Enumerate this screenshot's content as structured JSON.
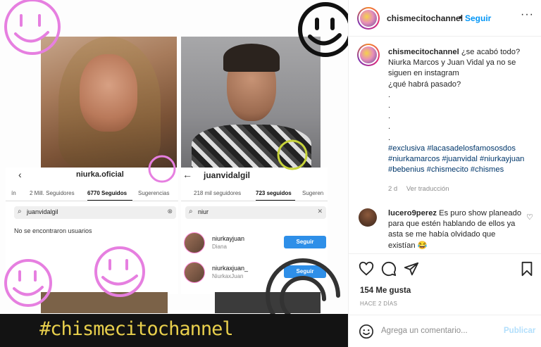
{
  "media": {
    "left_panel": {
      "username": "niurka.oficial",
      "tabs": [
        "ín",
        "2 Mill. Seguidores",
        "6770 Seguidos",
        "Sugerencias"
      ],
      "search_value": "juanvidalgil",
      "empty_text": "No se encontraron usuarios"
    },
    "right_panel": {
      "username": "juanvidalgil",
      "tabs": [
        "218 mil seguidores",
        "723 seguidos",
        "Sugeren"
      ],
      "search_value": "niur",
      "results": [
        {
          "username": "niurkayjuan",
          "name": "Diana",
          "button": "Seguir"
        },
        {
          "username": "niurkaxjuan_",
          "name": "NiurkaxJuan",
          "button": "Seguir"
        }
      ]
    },
    "hashtag_overlay": "#chismecitochannel"
  },
  "header": {
    "username": "chismecitochannel",
    "dot": "•",
    "follow_label": "Seguir",
    "more_label": "···"
  },
  "caption": {
    "username": "chismecitochannel",
    "lines": [
      "¿se acabó todo?",
      "Niurka Marcos y Juan Vidal ya no se siguen en instagram",
      "¿qué habrá pasado?",
      ".",
      ".",
      ".",
      ".",
      "."
    ],
    "hashtags": "#exclusiva #lacasadelosfamososdos #niurkamarcos #juanvidal #niurkayjuan #bebenius #chismecito #chismes",
    "time": "2 d",
    "translation": "Ver traducción"
  },
  "comment": {
    "username": "lucero9perez",
    "text": "Es puro show planeado para que estén hablando de ellos ya asta se me había olvidado que existían 😂"
  },
  "actions": {
    "likes": "154 Me gusta",
    "ago": "HACE 2 DÍAS"
  },
  "add_comment": {
    "placeholder": "Agrega un comentario...",
    "publish_label": "Publicar"
  },
  "colors": {
    "accent": "#0095f6",
    "publish_disabled": "#b2dffc",
    "hashtag_link": "#00376b",
    "smiley_pink": "#e67fe0",
    "hashtag_yellow": "#e8cf4c"
  }
}
